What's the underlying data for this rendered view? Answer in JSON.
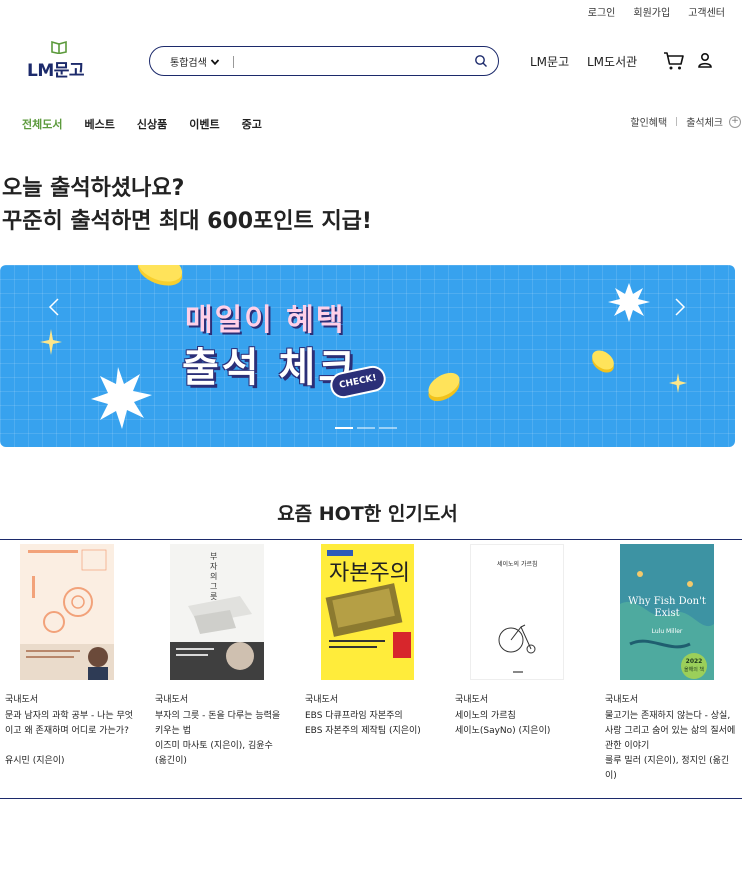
{
  "util_links": [
    "로그인",
    "회원가입",
    "고객센터"
  ],
  "logo": {
    "text": "LM문고"
  },
  "search": {
    "category": "통합검색",
    "placeholder": "",
    "value": ""
  },
  "header_links": [
    "LM문고",
    "LM도서관"
  ],
  "category_nav": [
    {
      "label": "전체도서",
      "active": true
    },
    {
      "label": "베스트",
      "active": false
    },
    {
      "label": "신상품",
      "active": false
    },
    {
      "label": "이벤트",
      "active": false
    },
    {
      "label": "중고",
      "active": false
    }
  ],
  "sub_nav": [
    "할인혜택",
    "출석체크"
  ],
  "headline": {
    "line1": "오늘 출석하셨나요?",
    "line2": "꾸준히 출석하면 최대 600포인트 지급!"
  },
  "banner": {
    "line1": "매일이 혜택",
    "line2": "출석 체크",
    "badge": "CHECK!",
    "slide_count": 3,
    "active_slide": 0
  },
  "section_title": "요즘 HOT한 인기도서",
  "books": [
    {
      "category": "국내도서",
      "title": "문과 남자의 과학 공부 - 나는 무엇이고 왜 존재하며 어디로 가는가?",
      "author": "유시민 (지은이)"
    },
    {
      "category": "국내도서",
      "title": "부자의 그릇 - 돈을 다루는 능력을 키우는 법",
      "author": "이즈미 마사토 (지은이), 김윤수 (옮긴이)"
    },
    {
      "category": "국내도서",
      "title": "EBS 다큐프라임 자본주의",
      "author": "EBS 자본주의 제작팀 (지은이)"
    },
    {
      "category": "국내도서",
      "title": "세이노의 가르침",
      "author": "세이노(SayNo) (지은이)"
    },
    {
      "category": "국내도서",
      "title": "물고기는 존재하지 않는다 - 상실, 사랑 그리고 숨어 있는 삶의 질서에 관한 이야기",
      "author": "룰루 밀러 (지은이), 정지인 (옮긴이)"
    }
  ],
  "book_cover_text": {
    "b2_title": "부자의 그릇",
    "b3_title": "자본주의",
    "b4_title": "세이노의 가르침",
    "b5_title": "Why Fish Don't Exist",
    "b5_author": "Lulu Miller",
    "b5_badge_year": "2022",
    "b5_badge": "올해의 책"
  },
  "colors": {
    "brand_navy": "#1c2a6b",
    "active_green": "#5c9a3c",
    "banner_blue": "#37a2ee"
  }
}
